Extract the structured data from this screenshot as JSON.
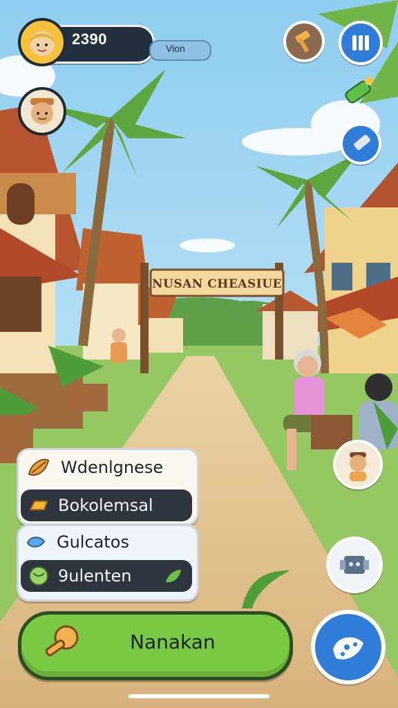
{
  "hud": {
    "coins": "2390",
    "label": "Vion"
  },
  "scene": {
    "banner_text": "NUSAN CHEASIUE"
  },
  "menu": {
    "items": [
      {
        "label": "Wdenlgnese",
        "icon": "leaf-bundle-icon"
      },
      {
        "label": "Bokolemsal",
        "icon": "gold-bar-icon"
      },
      {
        "label": "Gulcatos",
        "icon": "fish-icon"
      },
      {
        "label": "9ulenten",
        "icon": "ball-icon"
      }
    ]
  },
  "action": {
    "label": "Nanakan"
  },
  "colors": {
    "sky": "#bfe3f6",
    "path": "#e2c494",
    "grass": "#8fc45a",
    "action_green": "#7ac943",
    "hud_dark": "#23313f",
    "accent_blue": "#2f7cd9"
  }
}
